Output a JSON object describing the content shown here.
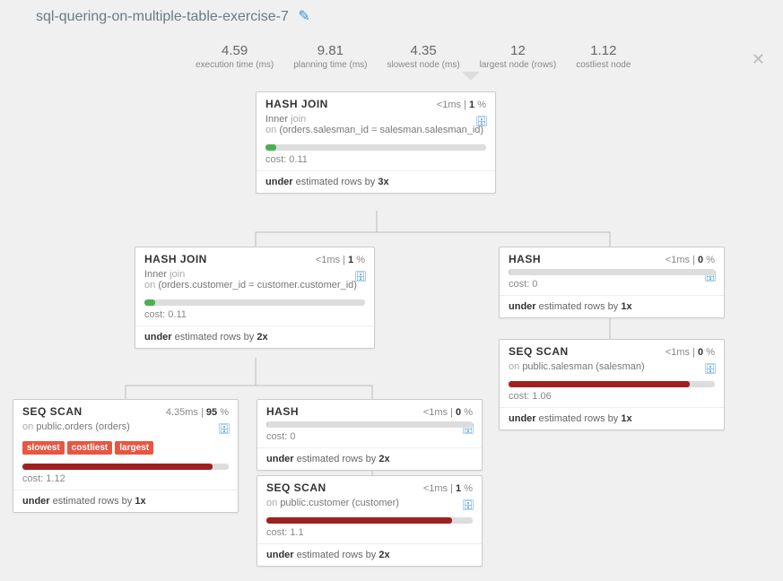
{
  "title": "sql-quering-on-multiple-table-exercise-7",
  "stats": {
    "exec_v": "4.59",
    "exec_l": "execution time (ms)",
    "plan_v": "9.81",
    "plan_l": "planning time (ms)",
    "slow_v": "4.35",
    "slow_l": "slowest node (ms)",
    "large_v": "12",
    "large_l": "largest node (rows)",
    "cost_v": "1.12",
    "cost_l": "costliest node"
  },
  "icons": {
    "close": "✕",
    "edit": "✎",
    "db": "🗄"
  },
  "labels": {
    "cost": "cost:",
    "under": "under",
    "est_rows_by": "estimated rows by",
    "inner": "Inner",
    "join": "join",
    "on": "on"
  },
  "nodes": {
    "n1": {
      "title": "HASH JOIN",
      "time": "<1ms",
      "pct": "1",
      "cond": "(orders.salesman_id = salesman.salesman_id)",
      "cost": "0.11",
      "est_x": "3x",
      "bar_w": "5%",
      "bar_c": "#4caf50"
    },
    "n2": {
      "title": "HASH JOIN",
      "time": "<1ms",
      "pct": "1",
      "cond": "(orders.customer_id = customer.customer_id)",
      "cost": "0.11",
      "est_x": "2x",
      "bar_w": "5%",
      "bar_c": "#4caf50"
    },
    "n3": {
      "title": "HASH",
      "time": "<1ms",
      "pct": "0",
      "cost": "0",
      "est_x": "1x",
      "bar_w": "1%",
      "bar_c": "#ccc"
    },
    "n4": {
      "title": "SEQ SCAN",
      "time": "<1ms",
      "pct": "0",
      "on": "public.salesman (salesman)",
      "cost": "1.06",
      "est_x": "1x",
      "bar_w": "88%",
      "bar_c": "#a02020"
    },
    "n5": {
      "title": "SEQ SCAN",
      "time": "4.35ms",
      "pct": "95",
      "on": "public.orders (orders)",
      "tags": [
        "slowest",
        "costliest",
        "largest"
      ],
      "cost": "1.12",
      "est_x": "1x",
      "bar_w": "92%",
      "bar_c": "#a02020"
    },
    "n6": {
      "title": "HASH",
      "time": "<1ms",
      "pct": "0",
      "cost": "0",
      "est_x": "2x",
      "bar_w": "1%",
      "bar_c": "#ccc"
    },
    "n7": {
      "title": "SEQ SCAN",
      "time": "<1ms",
      "pct": "1",
      "on": "public.customer (customer)",
      "cost": "1.1",
      "est_x": "2x",
      "bar_w": "90%",
      "bar_c": "#a02020"
    }
  }
}
